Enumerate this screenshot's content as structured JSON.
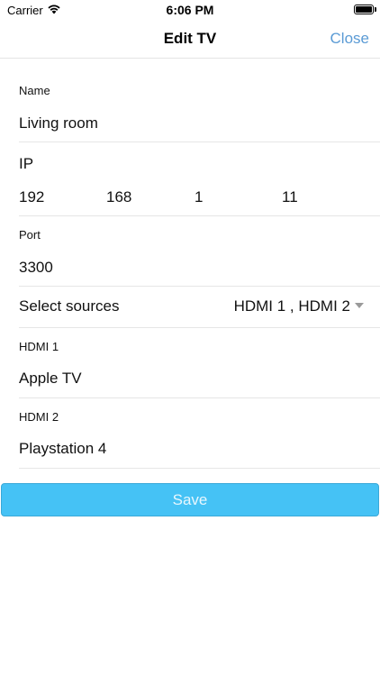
{
  "status_bar": {
    "carrier": "Carrier",
    "time": "6:06 PM"
  },
  "nav": {
    "title": "Edit TV",
    "close_label": "Close",
    "close_color": "#5b9bd5"
  },
  "form": {
    "name": {
      "label": "Name",
      "value": "Living room"
    },
    "ip": {
      "label": "IP",
      "parts": [
        "192",
        "168",
        "1",
        "11"
      ]
    },
    "port": {
      "label": "Port",
      "value": "3300"
    },
    "sources": {
      "label": "Select sources",
      "selected": "HDMI 1 , HDMI 2"
    },
    "hdmi1": {
      "label": "HDMI 1",
      "value": "Apple TV"
    },
    "hdmi2": {
      "label": "HDMI 2",
      "value": "Playstation 4"
    }
  },
  "save": {
    "label": "Save",
    "color": "#45c2f5"
  }
}
